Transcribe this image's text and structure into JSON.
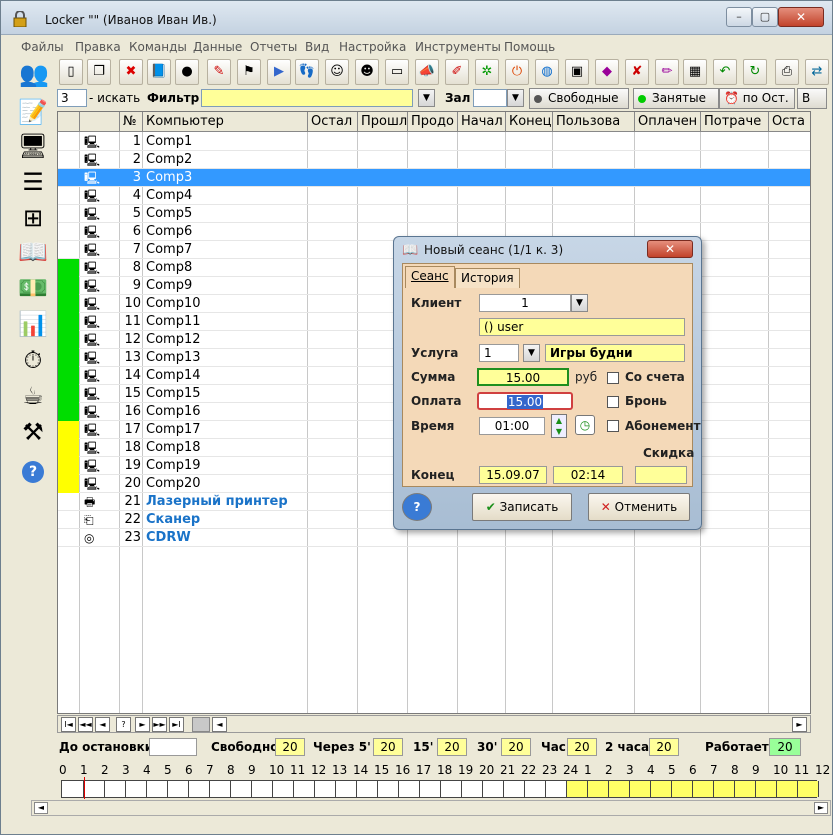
{
  "window": {
    "title": "Locker  \"\"  (Иванов Иван Ив.)",
    "minimize": "–",
    "restore": "▢",
    "close": "✕"
  },
  "menu": [
    "Файлы",
    "Правка",
    "Команды",
    "Данные",
    "Отчеты",
    "Вид",
    "Настройка",
    "Инструменты",
    "Помощь"
  ],
  "filter": {
    "count_value": "3",
    "search_label": "- искать",
    "filter_label": "Фильтр",
    "hall_label": "Зал",
    "free_button": "Свободные",
    "busy_button": "Занятые",
    "by_rest_button": "по Ост.",
    "more_label": "В"
  },
  "grid": {
    "headers": [
      "№",
      "Компьютер",
      "Остал",
      "Прошл",
      "Продо",
      "Начал",
      "Конец",
      "Пользова",
      "Оплачен",
      "Потраче",
      "Оста"
    ],
    "rows": [
      {
        "num": "1",
        "name": "Comp1",
        "status": "none",
        "type": "pc"
      },
      {
        "num": "2",
        "name": "Comp2",
        "status": "none",
        "type": "pc"
      },
      {
        "num": "3",
        "name": "Comp3",
        "status": "none",
        "type": "pc",
        "selected": true
      },
      {
        "num": "4",
        "name": "Comp4",
        "status": "none",
        "type": "pc"
      },
      {
        "num": "5",
        "name": "Comp5",
        "status": "none",
        "type": "pc"
      },
      {
        "num": "6",
        "name": "Comp6",
        "status": "none",
        "type": "pc"
      },
      {
        "num": "7",
        "name": "Comp7",
        "status": "none",
        "type": "pc"
      },
      {
        "num": "8",
        "name": "Comp8",
        "status": "green",
        "type": "pc"
      },
      {
        "num": "9",
        "name": "Comp9",
        "status": "green",
        "type": "pc"
      },
      {
        "num": "10",
        "name": "Comp10",
        "status": "green",
        "type": "pc"
      },
      {
        "num": "11",
        "name": "Comp11",
        "status": "green",
        "type": "pc"
      },
      {
        "num": "12",
        "name": "Comp12",
        "status": "green",
        "type": "pc"
      },
      {
        "num": "13",
        "name": "Comp13",
        "status": "green",
        "type": "pc"
      },
      {
        "num": "14",
        "name": "Comp14",
        "status": "green",
        "type": "pc"
      },
      {
        "num": "15",
        "name": "Comp15",
        "status": "green",
        "type": "pc"
      },
      {
        "num": "16",
        "name": "Comp16",
        "status": "green",
        "type": "pc"
      },
      {
        "num": "17",
        "name": "Comp17",
        "status": "yellow",
        "type": "pc"
      },
      {
        "num": "18",
        "name": "Comp18",
        "status": "yellow",
        "type": "pc"
      },
      {
        "num": "19",
        "name": "Comp19",
        "status": "yellow",
        "type": "pc"
      },
      {
        "num": "20",
        "name": "Comp20",
        "status": "yellow",
        "type": "pc"
      },
      {
        "num": "21",
        "name": "Лазерный принтер",
        "status": "none",
        "type": "printer"
      },
      {
        "num": "22",
        "name": "Сканер",
        "status": "none",
        "type": "scanner"
      },
      {
        "num": "23",
        "name": "CDRW",
        "status": "none",
        "type": "cd"
      }
    ],
    "nav_buttons": [
      "I◄",
      "◄◄",
      "◄",
      "?",
      "►",
      "►►",
      "►I"
    ]
  },
  "status": {
    "until_stop_label": "До остановки",
    "free_label": "Свободно",
    "free_value": "20",
    "in5_label": "Через 5'",
    "in5_value": "20",
    "in15_label": "15'",
    "in15_value": "20",
    "in30_label": "30'",
    "in30_value": "20",
    "hour_label": "Час",
    "hour_value": "20",
    "two_hours_label": "2 часа",
    "two_hours_value": "20",
    "working_label": "Работает",
    "working_value": "20"
  },
  "hours": [
    "0",
    "1",
    "2",
    "3",
    "4",
    "5",
    "6",
    "7",
    "8",
    "9",
    "10",
    "11",
    "12",
    "13",
    "14",
    "15",
    "16",
    "17",
    "18",
    "19",
    "20",
    "21",
    "22",
    "23",
    "24",
    "1",
    "2",
    "3",
    "4",
    "5",
    "6",
    "7",
    "8",
    "9",
    "10",
    "11",
    "12"
  ],
  "dialog": {
    "title": "Новый сеанс (1/1 к. 3)",
    "close": "✕",
    "tab_session": "Сеанс",
    "tab_history": "История",
    "client_label": "Клиент",
    "client_value": "1",
    "client_name": "() user",
    "service_label": "Услуга",
    "service_value": "1",
    "service_name": "Игры будни",
    "sum_label": "Сумма",
    "sum_value": "15.00",
    "currency": "руб",
    "from_account_label": "Со счета",
    "payment_label": "Оплата",
    "payment_value": "15.00",
    "reserve_label": "Бронь",
    "time_label": "Время",
    "time_value": "01:00",
    "subscription_label": "Абонемент",
    "discount_label": "Скидка",
    "end_label": "Конец",
    "end_date": "15.09.07",
    "end_time": "02:14",
    "help_button": "?",
    "save_button": "Записать",
    "cancel_button": "Отменить"
  },
  "colors": {
    "selected": "#3399ff",
    "busy": "#00dd00",
    "warning": "#ffff00",
    "dialog_panel": "#f4d9b8"
  }
}
